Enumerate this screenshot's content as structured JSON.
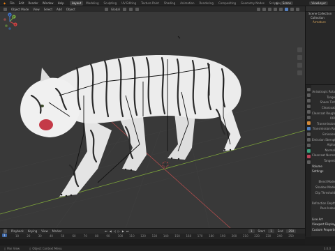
{
  "topbar": {
    "menus": [
      "File",
      "Edit",
      "Render",
      "Window",
      "Help"
    ],
    "workspaces": [
      "Layout",
      "Modeling",
      "Sculpting",
      "UV Editing",
      "Texture Paint",
      "Shading",
      "Animation",
      "Rendering",
      "Compositing",
      "Geometry Nodes",
      "Scripting"
    ],
    "active_workspace": "Layout",
    "scene": "Scene",
    "view_layer": "ViewLayer"
  },
  "viewport_header": {
    "mode": "Object Mode",
    "menus": [
      "View",
      "Select",
      "Add",
      "Object"
    ],
    "transform": "Global"
  },
  "outliner": {
    "rows": [
      "Scene Collection",
      "Collection",
      "Armature"
    ]
  },
  "properties": {
    "rows": [
      {
        "label": "Anisotropic Rota",
        "section": false
      },
      {
        "label": "Tange",
        "section": false
      },
      {
        "label": "Sheen Tint",
        "section": false
      },
      {
        "label": "Clearcoat",
        "section": false
      },
      {
        "label": "Clearcoat Rough",
        "section": false
      },
      {
        "label": "IOR",
        "section": false
      },
      {
        "label": "Transmission",
        "section": false
      },
      {
        "label": "Transmission Ro",
        "section": false
      },
      {
        "label": "Emission",
        "section": false
      },
      {
        "label": "Emission Strength",
        "section": false
      },
      {
        "label": "Alpha",
        "section": false
      },
      {
        "label": "Normal",
        "section": false
      },
      {
        "label": "Clearcoat Normal",
        "section": false
      },
      {
        "label": "Tangent",
        "section": false
      },
      {
        "label": "Volume",
        "section": true
      },
      {
        "label": "Settings",
        "section": true
      },
      {
        "label": "",
        "section": false
      },
      {
        "label": "Blend Mode",
        "section": false
      },
      {
        "label": "Shadow Mode",
        "section": false
      },
      {
        "label": "Clip Threshold",
        "section": false
      },
      {
        "label": "",
        "section": false
      },
      {
        "label": "Refraction Depth",
        "section": false
      },
      {
        "label": "Pass Index",
        "section": false
      },
      {
        "label": "",
        "section": false
      },
      {
        "label": "Line Art",
        "section": true
      },
      {
        "label": "Viewport Display",
        "section": true
      },
      {
        "label": "Custom Properties",
        "section": true
      }
    ]
  },
  "timeline_header": {
    "menus": [
      "Playback",
      "Keying",
      "View",
      "Marker"
    ],
    "current_frame": "1",
    "start_label": "Start",
    "start": "1",
    "end_label": "End",
    "end": "250"
  },
  "timeline": {
    "frame_marker": "1",
    "ticks": [
      "10",
      "20",
      "30",
      "40",
      "50",
      "60",
      "70",
      "80",
      "90",
      "100",
      "110",
      "120",
      "130",
      "140",
      "150",
      "160",
      "170",
      "180",
      "190",
      "200",
      "210",
      "220",
      "230",
      "240",
      "250"
    ]
  },
  "statusbar": {
    "items": [
      "Pan View",
      "Object Context Menu"
    ],
    "version": "3.0.0"
  },
  "gizmo": {
    "x": "X",
    "y": "Y",
    "z": "Z"
  },
  "colors": {
    "viewport_bg": "#393939",
    "grid_x_axis": "#b34d4d",
    "grid_y_axis": "#7ea63a",
    "active_tab": "#3d3d3d",
    "frame_marker": "#3d67a6",
    "tiger_fur": "#e9e9e9",
    "tiger_stripe": "#2b2b2b"
  }
}
